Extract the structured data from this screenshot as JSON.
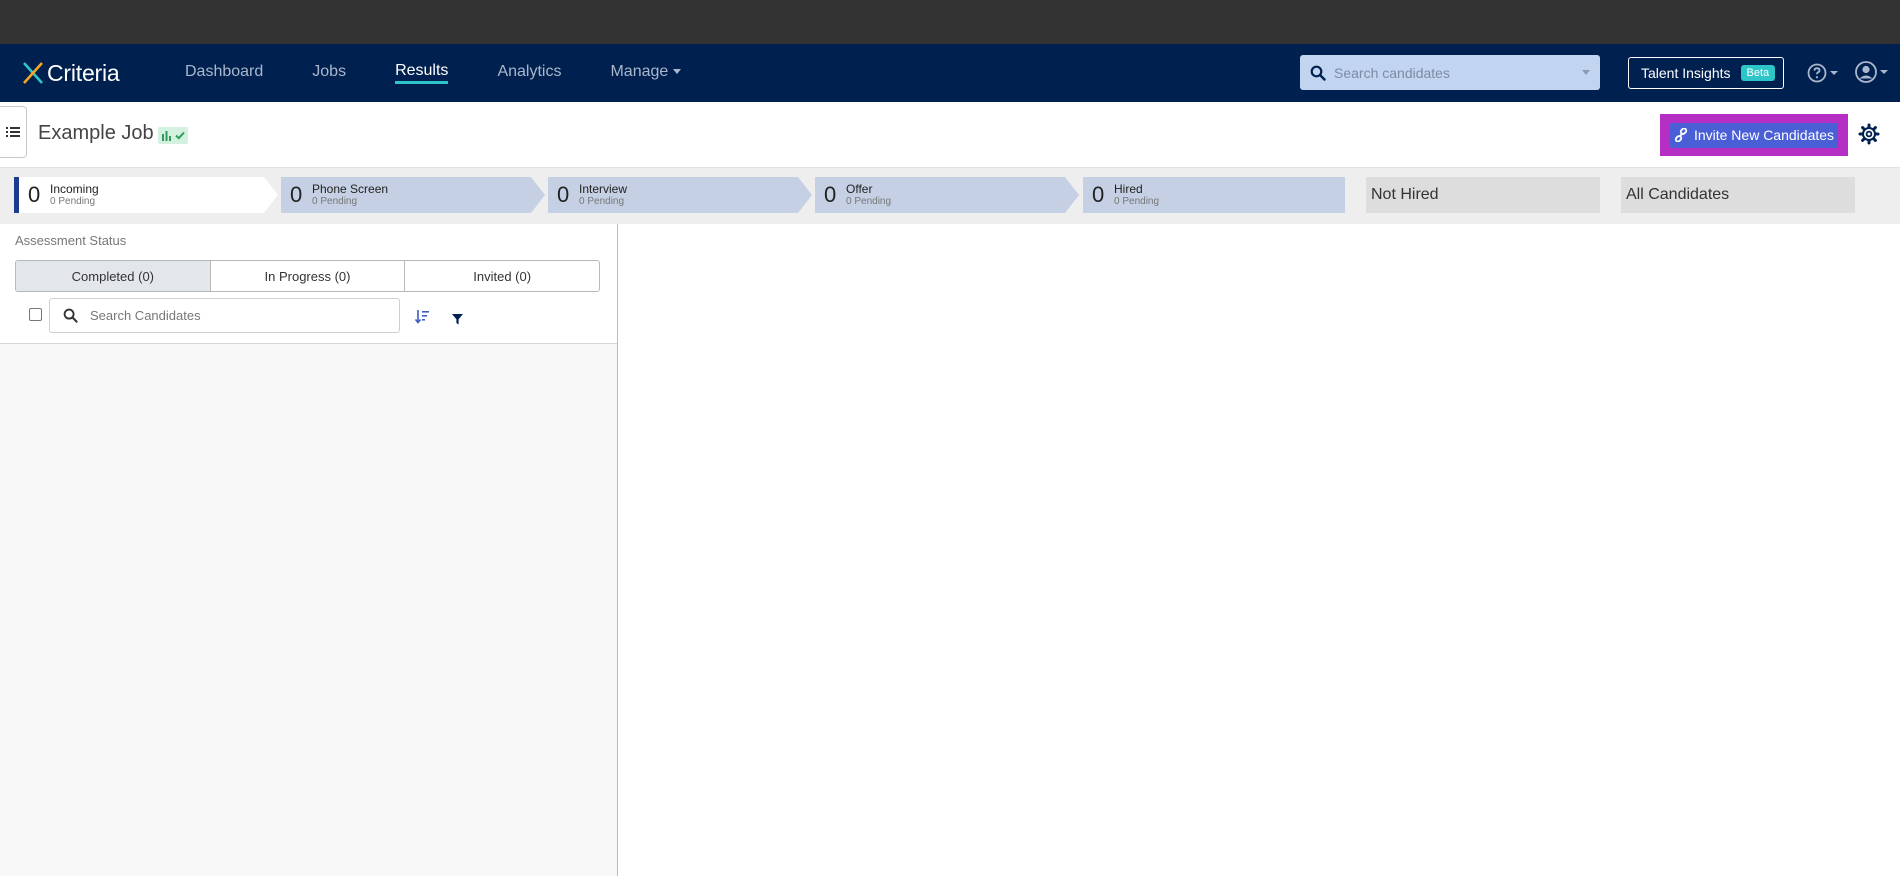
{
  "brand": {
    "name": "Criteria"
  },
  "nav": {
    "links": [
      {
        "label": "Dashboard",
        "active": false
      },
      {
        "label": "Jobs",
        "active": false
      },
      {
        "label": "Results",
        "active": true
      },
      {
        "label": "Analytics",
        "active": false
      },
      {
        "label": "Manage",
        "active": false,
        "dropdown": true
      }
    ],
    "search_placeholder": "Search candidates",
    "talent_insights_label": "Talent Insights",
    "beta_label": "Beta"
  },
  "job": {
    "title": "Example Job",
    "invite_label": "Invite New Candidates"
  },
  "pipeline": {
    "stages": [
      {
        "count": "0",
        "name": "Incoming",
        "pending": "0 Pending"
      },
      {
        "count": "0",
        "name": "Phone Screen",
        "pending": "0 Pending"
      },
      {
        "count": "0",
        "name": "Interview",
        "pending": "0 Pending"
      },
      {
        "count": "0",
        "name": "Offer",
        "pending": "0 Pending"
      },
      {
        "count": "0",
        "name": "Hired",
        "pending": "0 Pending"
      }
    ],
    "not_hired_label": "Not Hired",
    "all_candidates_label": "All Candidates"
  },
  "assessment": {
    "heading": "Assessment Status",
    "tabs": [
      {
        "label": "Completed (0)",
        "active": true
      },
      {
        "label": "In Progress (0)",
        "active": false
      },
      {
        "label": "Invited (0)",
        "active": false
      }
    ],
    "search_placeholder": "Search Candidates"
  },
  "colors": {
    "navbar": "#00204f",
    "accent_teal": "#2ec5c9",
    "invite_button": "#4a5fd6",
    "invite_highlight": "#b52fc4",
    "stage_active_border": "#1d3b8e"
  }
}
